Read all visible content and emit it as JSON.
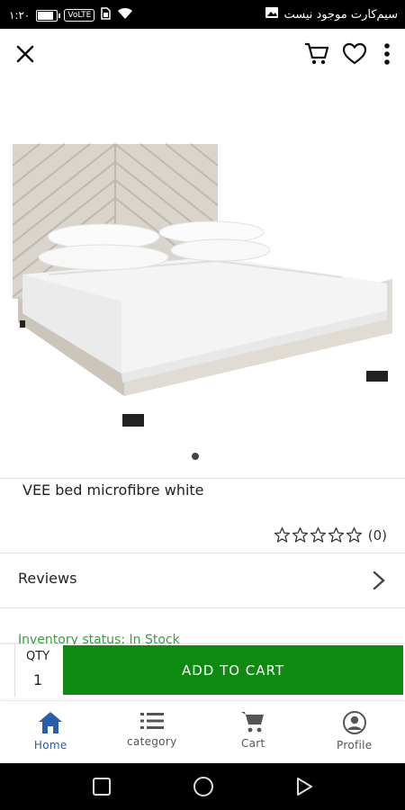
{
  "status_bar": {
    "time": "۱:۲۰",
    "volte": "VoLTE",
    "carrier_text": "سیم‌کارت موجود نیست",
    "battery_level": 0.85,
    "icons": [
      "signal-icon",
      "battery-icon",
      "sim-icon",
      "wifi-icon",
      "image-icon"
    ]
  },
  "app_bar": {
    "close_icon": "close-icon",
    "actions": [
      "cart-icon",
      "heart-icon",
      "more-vert-icon"
    ]
  },
  "product": {
    "title": "VEE bed microfibre white",
    "image_pages": 1,
    "active_page": 1,
    "rating_stars": 0,
    "rating_count": "(0)",
    "reviews_label": "Reviews",
    "inventory_status": "Inventory status: In Stock"
  },
  "cart_bar": {
    "qty_label": "QTY",
    "qty_value": "1",
    "add_to_cart_label": "ADD TO CART",
    "button_color": "#0f8a11"
  },
  "bottom_nav": {
    "items": [
      {
        "label": "Home",
        "icon": "home-icon",
        "active": true
      },
      {
        "label": "category",
        "icon": "list-icon",
        "active": false
      },
      {
        "label": "Cart",
        "icon": "cart-icon",
        "active": false
      },
      {
        "label": "Profile",
        "icon": "profile-icon",
        "active": false
      }
    ],
    "active_color": "#2a5fa8"
  },
  "system_nav": [
    "square-icon",
    "circle-icon",
    "triangle-icon"
  ]
}
